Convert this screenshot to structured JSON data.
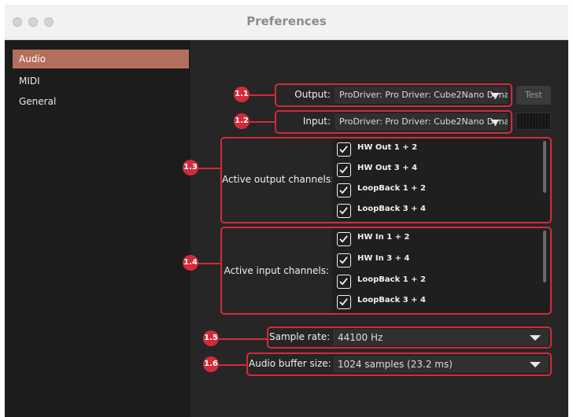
{
  "window": {
    "title": "Preferences"
  },
  "sidebar": {
    "items": [
      {
        "label": "Audio",
        "active": true
      },
      {
        "label": "MIDI",
        "active": false
      },
      {
        "label": "General",
        "active": false
      }
    ]
  },
  "output": {
    "label": "Output:",
    "value": "ProDriver: Pro Driver: Cube2Nano Dyna",
    "test_label": "Test"
  },
  "input": {
    "label": "Input:",
    "value": "ProDriver: Pro Driver: Cube2Nano Dyna"
  },
  "output_channels": {
    "label": "Active output channels:",
    "items": [
      {
        "label": "HW Out  1 + 2",
        "checked": true
      },
      {
        "label": "HW Out  3 + 4",
        "checked": true
      },
      {
        "label": "LoopBack 1 + 2",
        "checked": true
      },
      {
        "label": "LoopBack 3 + 4",
        "checked": true
      }
    ]
  },
  "input_channels": {
    "label": "Active input channels:",
    "items": [
      {
        "label": "HW In  1 + 2",
        "checked": true
      },
      {
        "label": "HW In  3 + 4",
        "checked": true
      },
      {
        "label": "LoopBack 1 + 2",
        "checked": true
      },
      {
        "label": "LoopBack 3 + 4",
        "checked": true
      }
    ]
  },
  "sample_rate": {
    "label": "Sample rate:",
    "value": "44100 Hz"
  },
  "buffer_size": {
    "label": "Audio buffer size:",
    "value": "1024 samples (23.2 ms)"
  },
  "annotations": [
    "1.1",
    "1.2",
    "1.3",
    "1.4",
    "1.5",
    "1.6"
  ],
  "colors": {
    "accent": "#b36e5c",
    "highlight": "#d22b3a",
    "background": "#262626",
    "sidebar": "#1c1c1c"
  }
}
